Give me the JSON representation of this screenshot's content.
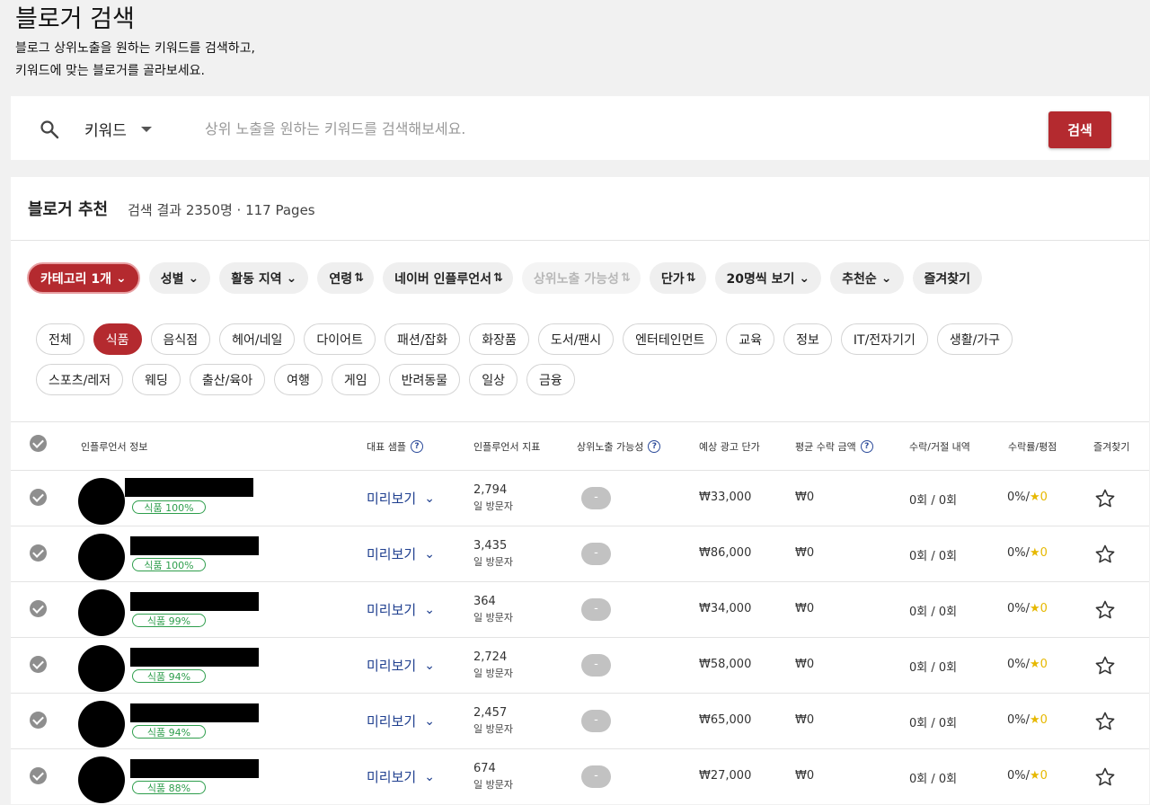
{
  "header": {
    "title": "블로거 검색",
    "desc_line1": "블로그 상위노출을 원하는 키워드를 검색하고,",
    "desc_line2": "키워드에 맞는 블로거를 골라보세요."
  },
  "search": {
    "type_label": "키워드",
    "placeholder": "상위 노출을 원하는 키워드를 검색해보세요.",
    "button_label": "검색"
  },
  "results": {
    "title": "블로거 추천",
    "summary": "검색 결과 2350명 · 117 Pages"
  },
  "filters": [
    {
      "label": "카테고리 1개",
      "kind": "dropdown",
      "active": true
    },
    {
      "label": "성별",
      "kind": "dropdown"
    },
    {
      "label": "활동 지역",
      "kind": "dropdown"
    },
    {
      "label": "연령",
      "kind": "sort"
    },
    {
      "label": "네이버 인플루언서",
      "kind": "sort"
    },
    {
      "label": "상위노출 가능성",
      "kind": "sort",
      "disabled": true
    },
    {
      "label": "단가",
      "kind": "sort"
    },
    {
      "label": "20명씩 보기",
      "kind": "dropdown"
    },
    {
      "label": "추천순",
      "kind": "dropdown"
    },
    {
      "label": "즐겨찾기",
      "kind": "plain"
    }
  ],
  "categories": [
    "전체",
    "식품",
    "음식점",
    "헤어/네일",
    "다이어트",
    "패션/잡화",
    "화장품",
    "도서/팬시",
    "엔터테인먼트",
    "교육",
    "정보",
    "IT/전자기기",
    "생활/가구",
    "스포츠/레저",
    "웨딩",
    "출산/육아",
    "여행",
    "게임",
    "반려동물",
    "일상",
    "금융"
  ],
  "active_category": "식품",
  "table": {
    "columns": {
      "info": "인플루언서 정보",
      "sample": "대표 샘플",
      "index": "인플루언서 지표",
      "exposure": "상위노출 가능성",
      "ad_price": "예상 광고 단가",
      "avg_income": "평균 수락 금액",
      "history": "수락/거절 내역",
      "rate": "수락률/평점",
      "favorite": "즐겨찾기"
    },
    "preview_label": "미리보기",
    "visitor_unit": "일 방문자",
    "rows": [
      {
        "badge": "식품 100%",
        "visitors": "2,794",
        "exposure": "-",
        "ad_price": "₩33,000",
        "avg_income": "₩0",
        "history": "0회 / 0회",
        "rate": "0%/",
        "score": "★0"
      },
      {
        "badge": "식품 100%",
        "visitors": "3,435",
        "exposure": "-",
        "ad_price": "₩86,000",
        "avg_income": "₩0",
        "history": "0회 / 0회",
        "rate": "0%/",
        "score": "★0"
      },
      {
        "badge": "식품 99%",
        "visitors": "364",
        "exposure": "-",
        "ad_price": "₩34,000",
        "avg_income": "₩0",
        "history": "0회 / 0회",
        "rate": "0%/",
        "score": "★0"
      },
      {
        "badge": "식품 94%",
        "visitors": "2,724",
        "exposure": "-",
        "ad_price": "₩58,000",
        "avg_income": "₩0",
        "history": "0회 / 0회",
        "rate": "0%/",
        "score": "★0"
      },
      {
        "badge": "식품 94%",
        "visitors": "2,457",
        "exposure": "-",
        "ad_price": "₩65,000",
        "avg_income": "₩0",
        "history": "0회 / 0회",
        "rate": "0%/",
        "score": "★0"
      },
      {
        "badge": "식품 88%",
        "visitors": "674",
        "exposure": "-",
        "ad_price": "₩27,000",
        "avg_income": "₩0",
        "history": "0회 / 0회",
        "rate": "0%/",
        "score": "★0"
      }
    ]
  },
  "colors": {
    "brand": "#b42a2f",
    "link": "#1f3f8f",
    "badge": "#2e9e4c",
    "star": "#e6b800"
  }
}
